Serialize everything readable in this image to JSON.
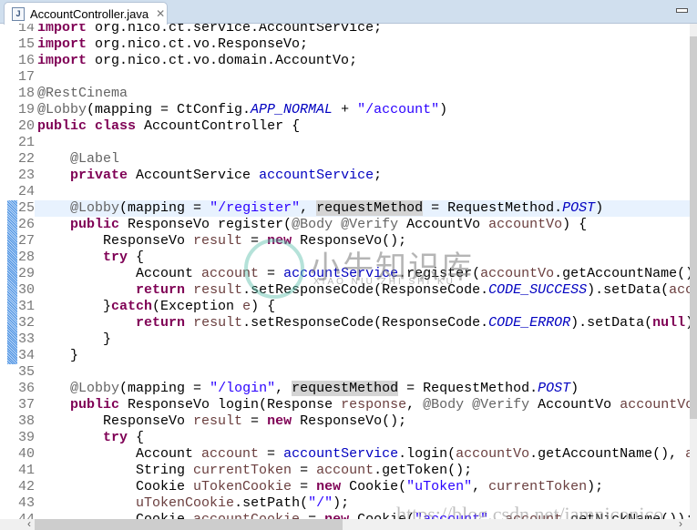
{
  "tab": {
    "title": "AccountController.java",
    "file_icon": "java-file-icon",
    "close_icon": "close-icon"
  },
  "colors": {
    "keyword": "#7f0055",
    "annotation": "#646464",
    "string": "#2a00ff",
    "field": "#0000c0",
    "local_var": "#6a3e3e",
    "current_line": "#e8f2fe",
    "occurrence": "#d4d4d4"
  },
  "current_line": 25,
  "range_marker": {
    "from": 25,
    "to": 34
  },
  "lines": [
    {
      "n": "14",
      "t": [
        [
          "import",
          "kw"
        ],
        [
          " org.nico.ct.service.AccountService;",
          ""
        ]
      ]
    },
    {
      "n": "15",
      "t": [
        [
          "import",
          "kw"
        ],
        [
          " org.nico.ct.vo.ResponseVo;",
          ""
        ]
      ]
    },
    {
      "n": "16",
      "t": [
        [
          "import",
          "kw"
        ],
        [
          " org.nico.ct.vo.domain.AccountVo;",
          ""
        ]
      ]
    },
    {
      "n": "17",
      "t": []
    },
    {
      "n": "18",
      "t": [
        [
          "@RestCinema",
          "ann"
        ]
      ]
    },
    {
      "n": "19",
      "t": [
        [
          "@Lobby",
          "ann"
        ],
        [
          "(mapping = CtConfig.",
          ""
        ],
        [
          "APP_NORMAL",
          "const"
        ],
        [
          " + ",
          ""
        ],
        [
          "\"/account\"",
          "str"
        ],
        [
          ")",
          ""
        ]
      ]
    },
    {
      "n": "20",
      "t": [
        [
          "public",
          "kw"
        ],
        [
          " ",
          ""
        ],
        [
          "class",
          "kw"
        ],
        [
          " AccountController {",
          ""
        ]
      ]
    },
    {
      "n": "21",
      "t": []
    },
    {
      "n": "22",
      "t": [
        [
          "    ",
          ""
        ],
        [
          "@Label",
          "ann"
        ]
      ]
    },
    {
      "n": "23",
      "t": [
        [
          "    ",
          ""
        ],
        [
          "private",
          "kw"
        ],
        [
          " AccountService ",
          ""
        ],
        [
          "accountService",
          "field"
        ],
        [
          ";",
          ""
        ]
      ]
    },
    {
      "n": "24",
      "t": []
    },
    {
      "n": "25",
      "t": [
        [
          "    ",
          ""
        ],
        [
          "@Lobby",
          "ann"
        ],
        [
          "(mapping = ",
          ""
        ],
        [
          "\"/register\"",
          "str"
        ],
        [
          ", ",
          ""
        ],
        [
          "requestMethod",
          "hl"
        ],
        [
          " = RequestMethod.",
          ""
        ],
        [
          "POST",
          "const"
        ],
        [
          ")",
          ""
        ]
      ]
    },
    {
      "n": "26",
      "t": [
        [
          "    ",
          ""
        ],
        [
          "public",
          "kw"
        ],
        [
          " ResponseVo register(",
          ""
        ],
        [
          "@Body",
          "ann"
        ],
        [
          " ",
          ""
        ],
        [
          "@Verify",
          "ann"
        ],
        [
          " AccountVo ",
          ""
        ],
        [
          "accountVo",
          "var"
        ],
        [
          ") {",
          ""
        ]
      ]
    },
    {
      "n": "27",
      "t": [
        [
          "        ResponseVo ",
          ""
        ],
        [
          "result",
          "var"
        ],
        [
          " = ",
          ""
        ],
        [
          "new",
          "kw"
        ],
        [
          " ResponseVo();",
          ""
        ]
      ]
    },
    {
      "n": "28",
      "t": [
        [
          "        ",
          ""
        ],
        [
          "try",
          "kw"
        ],
        [
          " {",
          ""
        ]
      ]
    },
    {
      "n": "29",
      "t": [
        [
          "            Account ",
          ""
        ],
        [
          "account",
          "var"
        ],
        [
          " = ",
          ""
        ],
        [
          "accountService",
          "field"
        ],
        [
          ".register(",
          ""
        ],
        [
          "accountVo",
          "var"
        ],
        [
          ".getAccountName(), ",
          ""
        ]
      ]
    },
    {
      "n": "30",
      "t": [
        [
          "            ",
          ""
        ],
        [
          "return",
          "kw"
        ],
        [
          " ",
          ""
        ],
        [
          "result",
          "var"
        ],
        [
          ".setResponseCode(ResponseCode.",
          ""
        ],
        [
          "CODE_SUCCESS",
          "const"
        ],
        [
          ").setData(",
          ""
        ],
        [
          "account",
          "var"
        ],
        [
          ");",
          ""
        ]
      ]
    },
    {
      "n": "31",
      "t": [
        [
          "        }",
          ""
        ],
        [
          "catch",
          "kw"
        ],
        [
          "(Exception ",
          ""
        ],
        [
          "e",
          "var"
        ],
        [
          ") {",
          ""
        ]
      ]
    },
    {
      "n": "32",
      "t": [
        [
          "            ",
          ""
        ],
        [
          "return",
          "kw"
        ],
        [
          " ",
          ""
        ],
        [
          "result",
          "var"
        ],
        [
          ".setResponseCode(ResponseCode.",
          ""
        ],
        [
          "CODE_ERROR",
          "const"
        ],
        [
          ").setData(",
          ""
        ],
        [
          "null",
          "kw"
        ],
        [
          ");",
          ""
        ]
      ]
    },
    {
      "n": "33",
      "t": [
        [
          "        }",
          ""
        ]
      ]
    },
    {
      "n": "34",
      "t": [
        [
          "    }",
          ""
        ]
      ]
    },
    {
      "n": "35",
      "t": []
    },
    {
      "n": "36",
      "t": [
        [
          "    ",
          ""
        ],
        [
          "@Lobby",
          "ann"
        ],
        [
          "(mapping = ",
          ""
        ],
        [
          "\"/login\"",
          "str"
        ],
        [
          ", ",
          ""
        ],
        [
          "requestMethod",
          "hl"
        ],
        [
          " = RequestMethod.",
          ""
        ],
        [
          "POST",
          "const"
        ],
        [
          ")",
          ""
        ]
      ]
    },
    {
      "n": "37",
      "t": [
        [
          "    ",
          ""
        ],
        [
          "public",
          "kw"
        ],
        [
          " ResponseVo login(Response ",
          ""
        ],
        [
          "response",
          "var"
        ],
        [
          ", ",
          ""
        ],
        [
          "@Body",
          "ann"
        ],
        [
          " ",
          ""
        ],
        [
          "@Verify",
          "ann"
        ],
        [
          " AccountVo ",
          ""
        ],
        [
          "accountVo",
          "var"
        ],
        [
          ") {",
          ""
        ]
      ]
    },
    {
      "n": "38",
      "t": [
        [
          "        ResponseVo ",
          ""
        ],
        [
          "result",
          "var"
        ],
        [
          " = ",
          ""
        ],
        [
          "new",
          "kw"
        ],
        [
          " ResponseVo();",
          ""
        ]
      ]
    },
    {
      "n": "39",
      "t": [
        [
          "        ",
          ""
        ],
        [
          "try",
          "kw"
        ],
        [
          " {",
          ""
        ]
      ]
    },
    {
      "n": "40",
      "t": [
        [
          "            Account ",
          ""
        ],
        [
          "account",
          "var"
        ],
        [
          " = ",
          ""
        ],
        [
          "accountService",
          "field"
        ],
        [
          ".login(",
          ""
        ],
        [
          "accountVo",
          "var"
        ],
        [
          ".getAccountName(), ",
          ""
        ],
        [
          "accountVo",
          "var"
        ]
      ]
    },
    {
      "n": "41",
      "t": [
        [
          "            String ",
          ""
        ],
        [
          "currentToken",
          "var"
        ],
        [
          " = ",
          ""
        ],
        [
          "account",
          "var"
        ],
        [
          ".getToken();",
          ""
        ]
      ]
    },
    {
      "n": "42",
      "t": [
        [
          "            Cookie ",
          ""
        ],
        [
          "uTokenCookie",
          "var"
        ],
        [
          " = ",
          ""
        ],
        [
          "new",
          "kw"
        ],
        [
          " Cookie(",
          ""
        ],
        [
          "\"uToken\"",
          "str"
        ],
        [
          ", ",
          ""
        ],
        [
          "currentToken",
          "var"
        ],
        [
          ");",
          ""
        ]
      ]
    },
    {
      "n": "43",
      "t": [
        [
          "            ",
          ""
        ],
        [
          "uTokenCookie",
          "var"
        ],
        [
          ".setPath(",
          ""
        ],
        [
          "\"/\"",
          "str"
        ],
        [
          ");",
          ""
        ]
      ]
    },
    {
      "n": "44",
      "t": [
        [
          "            Cookie ",
          ""
        ],
        [
          "accountCookie",
          "var"
        ],
        [
          " = ",
          ""
        ],
        [
          "new",
          "kw"
        ],
        [
          " Cookie(",
          ""
        ],
        [
          "\"account\"",
          "str"
        ],
        [
          ", ",
          ""
        ],
        [
          "account",
          "var"
        ],
        [
          ".getNickName());",
          ""
        ]
      ]
    }
  ],
  "watermarks": {
    "brand_cn": "小牛知识库",
    "brand_pinyin": "XIAO NIU ZHI SHI KU",
    "url": "https://blog.csdn.net/iamniconico"
  }
}
